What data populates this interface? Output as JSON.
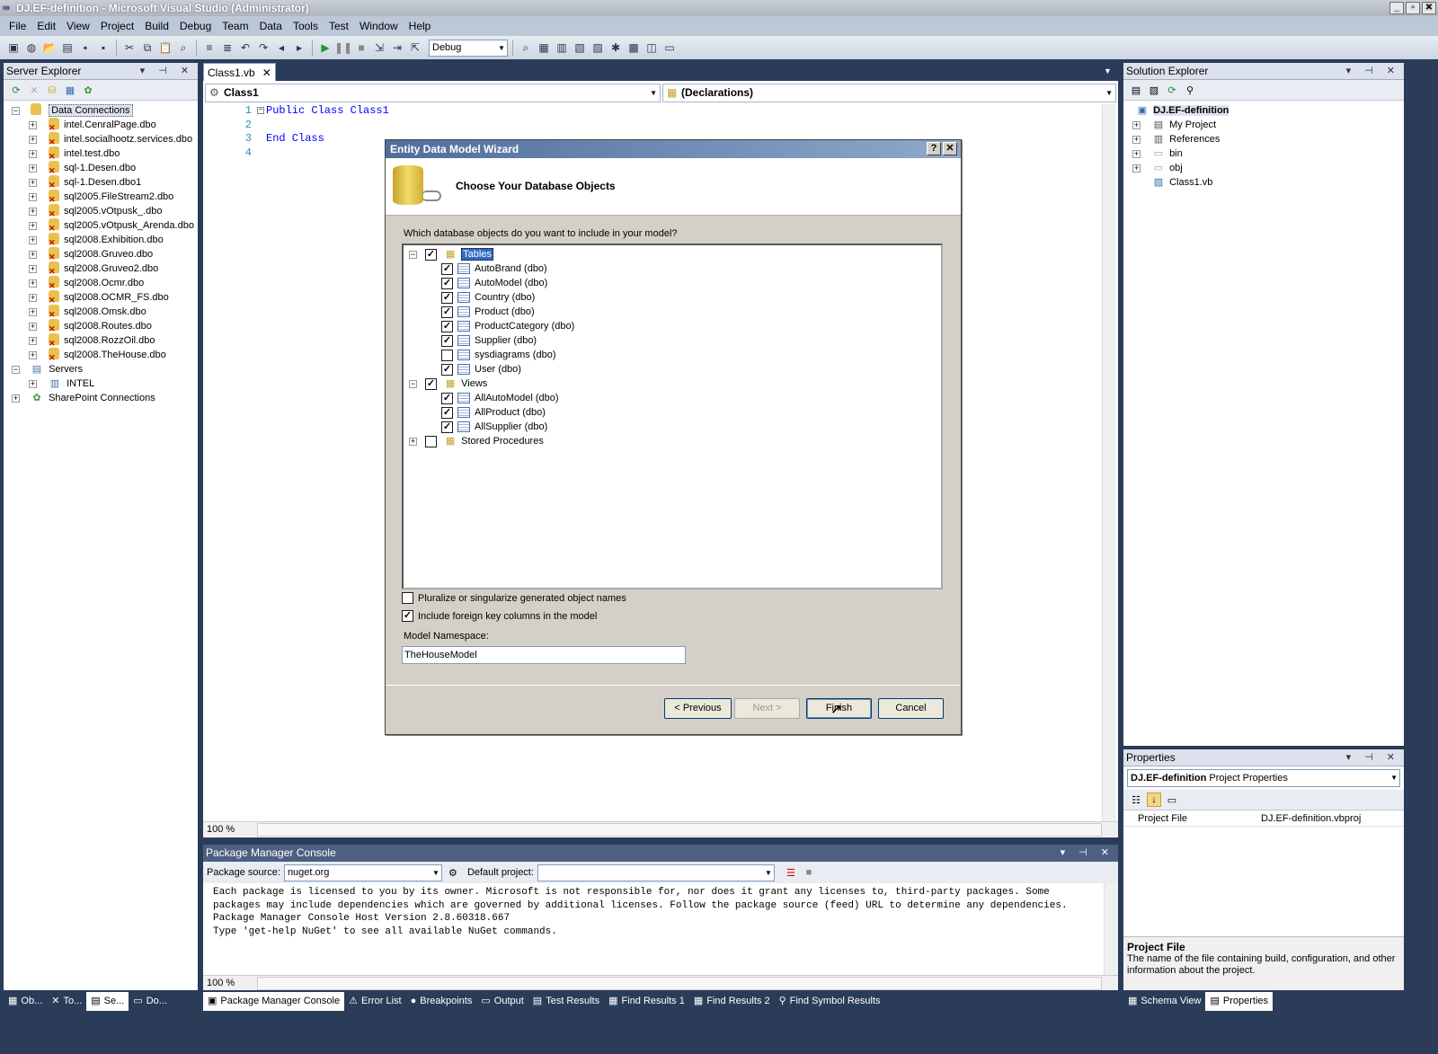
{
  "window": {
    "title": "DJ.EF-definition - Microsoft Visual Studio (Administrator)",
    "min": "_",
    "max": "▫",
    "close": "✕"
  },
  "menu": [
    "File",
    "Edit",
    "View",
    "Project",
    "Build",
    "Debug",
    "Team",
    "Data",
    "Tools",
    "Test",
    "Window",
    "Help"
  ],
  "toolbar": {
    "config": "Debug"
  },
  "server_explorer": {
    "title": "Server Explorer",
    "root": "Data Connections",
    "connections": [
      "intel.CenralPage.dbo",
      "intel.socialhootz.services.dbo",
      "intel.test.dbo",
      "sql-1.Desen.dbo",
      "sql-1.Desen.dbo1",
      "sql2005.FileStream2.dbo",
      "sql2005.vOtpusk_.dbo",
      "sql2005.vOtpusk_Arenda.dbo",
      "sql2008.Exhibition.dbo",
      "sql2008.Gruveo.dbo",
      "sql2008.Gruveo2.dbo",
      "sql2008.Ocmr.dbo",
      "sql2008.OCMR_FS.dbo",
      "sql2008.Omsk.dbo",
      "sql2008.Routes.dbo",
      "sql2008.RozzOil.dbo",
      "sql2008.TheHouse.dbo"
    ],
    "servers": "Servers",
    "server_item": "INTEL",
    "sharepoint": "SharePoint Connections"
  },
  "editor": {
    "tab": "Class1.vb",
    "class_combo": "Class1",
    "decl_combo": "(Declarations)",
    "line_numbers": [
      "1",
      "2",
      "3",
      "4"
    ],
    "line1_kw": "Public Class",
    "line1_name": "Class1",
    "line3": "End Class",
    "zoom": "100 %"
  },
  "dialog": {
    "title": "Entity Data Model Wizard",
    "help": "?",
    "close": "✕",
    "heading": "Choose Your Database Objects",
    "question": "Which database objects do you want to include in your model?",
    "tables_label": "Tables",
    "tables": [
      {
        "name": "AutoBrand (dbo)",
        "checked": true
      },
      {
        "name": "AutoModel (dbo)",
        "checked": true
      },
      {
        "name": "Country (dbo)",
        "checked": true
      },
      {
        "name": "Product (dbo)",
        "checked": true
      },
      {
        "name": "ProductCategory (dbo)",
        "checked": true
      },
      {
        "name": "Supplier (dbo)",
        "checked": true
      },
      {
        "name": "sysdiagrams (dbo)",
        "checked": false
      },
      {
        "name": "User (dbo)",
        "checked": true
      }
    ],
    "views_label": "Views",
    "views": [
      {
        "name": "AllAutoModel (dbo)",
        "checked": true
      },
      {
        "name": "AllProduct (dbo)",
        "checked": true
      },
      {
        "name": "AllSupplier (dbo)",
        "checked": true
      }
    ],
    "procs_label": "Stored Procedures",
    "pluralize_label": "Pluralize or singularize generated object names",
    "pluralize_checked": false,
    "fk_label": "Include foreign key columns in the model",
    "fk_checked": true,
    "namespace_label": "Model Namespace:",
    "namespace_value": "TheHouseModel",
    "btn_previous": "< Previous",
    "btn_next": "Next >",
    "btn_finish": "Finish",
    "btn_cancel": "Cancel"
  },
  "solution_explorer": {
    "title": "Solution Explorer",
    "project": "DJ.EF-definition",
    "items": [
      "My Project",
      "References",
      "bin",
      "obj",
      "Class1.vb"
    ]
  },
  "properties": {
    "title": "Properties",
    "object_name": "DJ.EF-definition",
    "object_type": "Project Properties",
    "row_name": "Project File",
    "row_value": "DJ.EF-definition.vbproj",
    "desc_title": "Project File",
    "desc_text": "The name of the file containing build, configuration, and other information about the project."
  },
  "package_manager": {
    "title": "Package Manager Console",
    "source_label": "Package source:",
    "source_value": "nuget.org",
    "project_label": "Default project:",
    "project_value": "",
    "lines": [
      "Each package is licensed to you by its owner. Microsoft is not responsible for, nor does it grant any licenses to, third-party packages. Some",
      "packages may include dependencies which are governed by additional licenses. Follow the package source (feed) URL to determine any dependencies.",
      "",
      "Package Manager Console Host Version 2.8.60318.667",
      "",
      "Type 'get-help NuGet' to see all available NuGet commands."
    ],
    "zoom": "100 %"
  },
  "bottom_tabs_left": [
    "Ob...",
    "To...",
    "Se...",
    "Do..."
  ],
  "bottom_tabs_center": [
    "Package Manager Console",
    "Error List",
    "Breakpoints",
    "Output",
    "Test Results",
    "Find Results 1",
    "Find Results 2",
    "Find Symbol Results"
  ],
  "bottom_tabs_right": [
    "Schema View",
    "Properties"
  ]
}
